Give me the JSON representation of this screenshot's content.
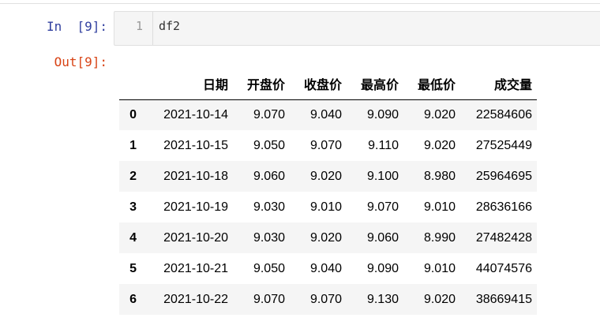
{
  "cell": {
    "in_prompt": "In  [9]:",
    "out_prompt": "Out[9]:",
    "line_number": "1",
    "code": "df2"
  },
  "dataframe": {
    "columns": [
      "日期",
      "开盘价",
      "收盘价",
      "最高价",
      "最低价",
      "成交量"
    ],
    "rows": [
      {
        "index": "0",
        "values": [
          "2021-10-14",
          "9.070",
          "9.040",
          "9.090",
          "9.020",
          "22584606"
        ]
      },
      {
        "index": "1",
        "values": [
          "2021-10-15",
          "9.050",
          "9.070",
          "9.110",
          "9.020",
          "27525449"
        ]
      },
      {
        "index": "2",
        "values": [
          "2021-10-18",
          "9.060",
          "9.020",
          "9.100",
          "8.980",
          "25964695"
        ]
      },
      {
        "index": "3",
        "values": [
          "2021-10-19",
          "9.030",
          "9.010",
          "9.070",
          "9.010",
          "28636166"
        ]
      },
      {
        "index": "4",
        "values": [
          "2021-10-20",
          "9.030",
          "9.020",
          "9.060",
          "8.990",
          "27482428"
        ]
      },
      {
        "index": "5",
        "values": [
          "2021-10-21",
          "9.050",
          "9.040",
          "9.090",
          "9.010",
          "44074576"
        ]
      },
      {
        "index": "6",
        "values": [
          "2021-10-22",
          "9.070",
          "9.070",
          "9.130",
          "9.020",
          "38669415"
        ]
      }
    ]
  },
  "colors": {
    "in_prompt": "#303f9f",
    "out_prompt": "#d84315",
    "input_background": "#f5f5f5",
    "striped_row": "#f5f5f5"
  }
}
